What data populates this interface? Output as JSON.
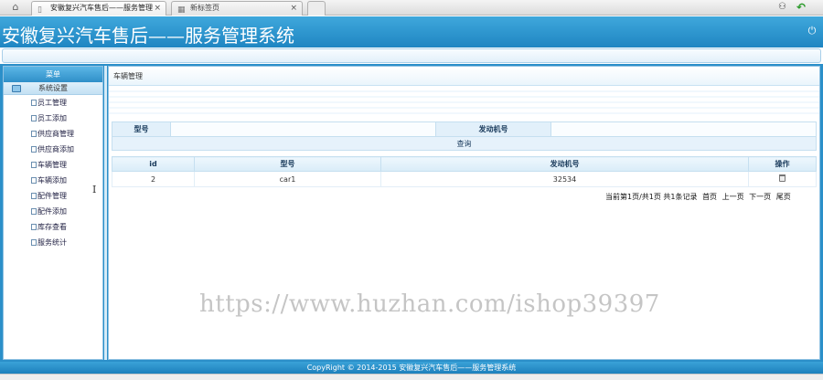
{
  "browser": {
    "tabs": [
      {
        "title": "安徽复兴汽车售后——服务管理",
        "icon": "page-icon"
      },
      {
        "title": "新标签页",
        "icon": "grid-icon"
      }
    ],
    "close_glyph": "×"
  },
  "header": {
    "title": "安徽复兴汽车售后——服务管理系统"
  },
  "sidebar": {
    "heading": "菜单",
    "group": "系统设置",
    "items": [
      {
        "label": "员工管理"
      },
      {
        "label": "员工添加"
      },
      {
        "label": "供应商管理"
      },
      {
        "label": "供应商添加"
      },
      {
        "label": "车辆管理"
      },
      {
        "label": "车辆添加"
      },
      {
        "label": "配件管理"
      },
      {
        "label": "配件添加"
      },
      {
        "label": "库存查看"
      },
      {
        "label": "服务统计"
      }
    ]
  },
  "main": {
    "title": "车辆管理",
    "search": {
      "model_label": "型号",
      "model_value": "",
      "engine_label": "发动机号",
      "engine_value": "",
      "query_button": "查询"
    },
    "table": {
      "columns": [
        "id",
        "型号",
        "发动机号",
        "操作"
      ],
      "rows": [
        {
          "id": "2",
          "model": "car1",
          "engine": "32534"
        }
      ]
    },
    "pager": {
      "summary": "当前第1页/共1页 共1条记录",
      "first": "首页",
      "prev": "上一页",
      "next": "下一页",
      "last": "尾页"
    }
  },
  "watermark": "https://www.huzhan.com/ishop39397",
  "footer": "CopyRight © 2014-2015 安徽复兴汽车售后——服务管理系统",
  "colors": {
    "accent": "#2b8fc9",
    "header_top": "#3fa8dc",
    "header_bottom": "#1f86c2"
  }
}
